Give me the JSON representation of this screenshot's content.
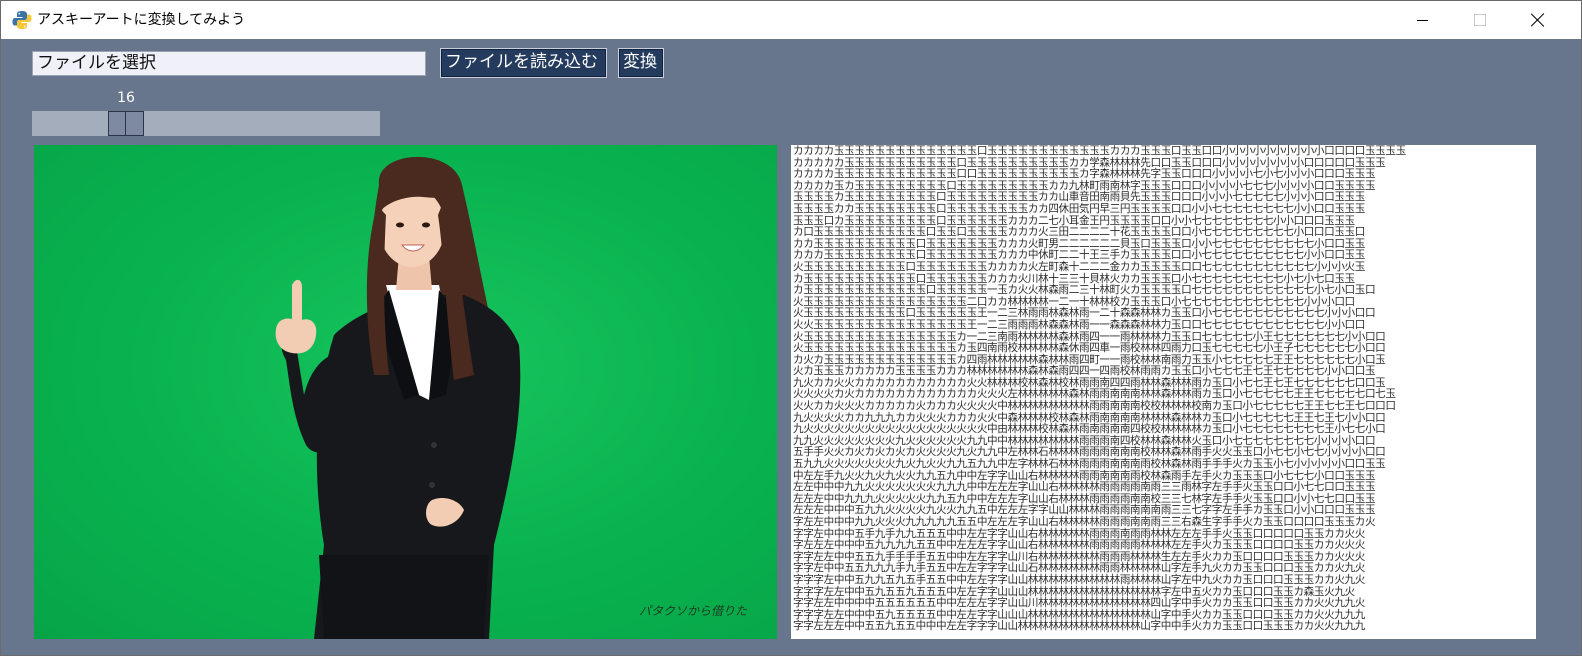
{
  "window": {
    "title": "アスキーアートに変換してみよう",
    "app_icon": "python-icon"
  },
  "controls": {
    "file_input_value": "ファイルを選択",
    "load_button_label": "ファイルを読み込む",
    "convert_button_label": "変換",
    "slider_value": "16"
  },
  "photo": {
    "credit": "パタクソから借りた"
  },
  "ascii_art": "カカカカ玉玉玉玉玉玉玉玉玉玉玉玉玉玉口玉玉玉玉玉玉玉玉玉玉玉玉カカカ玉玉玉口玉玉口口小小小小小小小小小小口口口口玉玉玉玉\nカカカカカ玉玉玉玉玉玉玉玉玉玉玉口玉玉玉玉玉玉玉玉玉玉カカ学森林林林先口口玉玉口口口小小小小小小小小口口口口口玉玉玉\nカカカカ玉玉玉玉玉玉玉玉玉玉玉玉口口玉玉玉玉玉玉玉玉玉玉カ字森林林林先字玉玉口口口小小小小七小七小小小口口口玉玉玉\nカカカカ玉カ玉玉玉玉玉玉玉玉玉口玉玉玉玉玉玉玉玉玉カカ九林町雨南林字玉玉玉口口口小小小小七七七小小小小口口玉玉玉玉\n玉玉玉玉カ玉玉玉玉玉玉玉玉玉口玉玉玉玉玉玉玉玉玉カカ山車音田南雨貝先玉玉玉口口口小小小七七七七七小小小口口玉玉玉\n玉玉玉玉カカ玉玉玉玉玉玉玉玉口玉玉玉玉玉玉玉玉カカ四休田気円早三円玉玉玉玉口口小小七七七七七七七七小小口口玉玉玉\n玉玉玉口カ玉玉玉玉玉玉玉玉玉口玉玉玉玉玉玉カカカ二七小耳金王円玉玉玉玉口口小小七七七七七七七七小小口口口玉玉玉\nカ口玉玉玉玉玉玉玉玉玉玉玉口玉玉口玉玉玉玉カカカ火三田二二二二十花玉玉玉玉口口小七七七七七七七七七小口口口玉玉口\nカカ玉玉玉玉玉玉玉玉玉玉口玉玉玉玉玉玉玉カカカ火町男二二二二二二貝玉口玉玉玉口小小七七七七七七七七七七小口口玉玉\nカカカ玉玉玉玉玉玉玉玉玉口玉玉玉玉玉玉玉カカカ中休町二二十王三手カ玉玉玉玉口口小七七七七七七七七七七小小口口玉玉\n火玉玉玉玉玉玉玉玉玉玉口玉玉玉玉玉玉玉カカカカ火左町森十二二二金カカ玉玉玉玉口口七七七七七七七七七七七小小小火玉\nカ玉玉玉玉玉玉玉玉玉玉玉口玉玉玉玉玉玉カカカ火川林十三三十貝林火カカ玉玉玉口小七七七七七七七七七小七小七口玉玉\nカ玉玉玉玉玉玉玉玉玉玉玉玉口玉玉玉玉玉一玉カ火火林森雨二三十林町火カ玉玉玉玉口七七七七七七七七七七七七小七小口玉口\n火玉玉玉玉玉玉玉玉玉玉玉玉玉玉玉玉二口カカ林林林林一二一十林林校カ玉玉玉口小七七七七七七七七七七七七小小小口口\n火玉玉玉玉玉玉玉玉玉玉口玉玉玉玉玉玉王一二三林雨雨林森林雨一二十森森林林カ玉玉口小七七七七七七七七七七七小小小口口\n火火玉玉玉玉玉玉玉玉玉玉玉玉玉玉玉王一二三雨雨雨林森森林雨一一森森森林林力玉口口七七七七七七七七七七七七小小口口\n火玉玉玉玉玉玉玉玉玉玉玉玉玉玉玉カ一二三南雨林林林林森林雨四一一雨林林林力玉玉口七七七七七小王七七七七七七七小小口口\n火玉玉玉玉玉玉玉玉玉玉玉玉玉玉玉カ玉四南雨校林林林林森休雨四車一雨校林林四雨力口玉七七七七七小王子七七七七七七小口口\nカ火カ玉玉玉玉玉玉玉玉玉玉玉玉玉カ四雨林林林林林森林林雨四町一一雨校林林南雨力玉玉小七七七七七王王七七七七七七小口玉\n火カ玉玉玉カカカカカ玉玉玉玉カカカ林林林林林林森林森雨四四一四雨校林雨雨カ玉玉口小七七七王七王七七七七七小小口口玉\n九火カカ火火カカカカカカカカカカカ火火林林林校林森林校林雨雨南四四雨林林森林林雨カ玉口小七七王七王七七七七七七口口玉\n火火火火カ火カカカカカカカカカカカカ火火火左林林林林林森林雨雨南南南林林森林林雨カ玉口小七七七七七王王七七七七七口七玉\n火火カカ火火火カカカカカ火カカカ火火火火中林林林林林林林林雨雨南南南校校林林林校南カ玉口小七七七七七王王七七王七口口口\n九火火火火カカ九九九カカ火火火カカカ火火中森林林林校林森林雨南南南南林林林森林林カ玉口小七七七七七王王七王七小小口口\n九火火火火火火火火火火火火火火火火火火中由林林林校林森林雨南雨南南四校校林林林林カ玉口小七七七七七七七七王小七七小口\n九九火火火火火火火火九火火火火火火九九中中林林林林林林林雨雨雨南四校林林森林林火玉口小七七七七七七七七小小小小口口\n五手手火火カ火カ火カ火カ火火火火九火九九中左林林石林林林雨雨雨南南南校林林森林雨手火火玉玉口小七七小七七小小小小口口\n五九九火火火火火火火九火九火火九九五九九中左字林林石林林雨雨雨南南南雨校林森林雨手手手火カ玉玉小七小小小小小口口玉玉\n中左左手九火火九火九火火九九五九中中左字字山山右林林林林雨雨南南南雨校林森雨手左手火カ玉玉玉口小七七七小口口玉玉玉\n左左中中中九九火火火火火火火九九九中中左左左字山山右林林林林雨雨雨雨南雨三三雨林字左手手火玉玉口口小七七口口玉玉玉\n左左左中中九九九火火火火火九九五九中中左左左字山山右林林林雨雨雨雨南南校三三七林字左手手火玉玉口口小小七七口口玉玉\n左左左中中中五九九火火火火九火火九九五中左左左字字山山林林林雨雨雨南南南雨三三七字字左手手カ玉玉口小小口口口玉玉玉\n字左左中中中九九火火火九九九九九五五中左左左字山山右林林林林雨雨雨南南雨三三右森生字手手火カ玉玉口口口口玉玉玉カ火\n字字左中中中五手九手九九五五五中中左左字字山山右林林林林林雨雨雨南雨雨林林左左左手手火玉玉口口口口口玉玉カカ火火\n字左左左中中中五九九九九五五中中左左左字字山山右林林林林林雨雨雨雨雨林林林左左手火カ玉玉玉口口口口玉玉カカ火火火\n字字左左中中五五九手手手手五五中中左左字字山川右林林林林林林雨雨雨林林林生左左手火カカ玉口口口口玉玉玉カカ火火火\n字字左中中五五九九九手九手五五中左左字字字山山石林林林林林林雨雨林林林林山字左手九火カカ玉玉口口口玉玉カカ火九火\n字字字左中中五九九五九五手五五中中左左字字山山林林林林林林林林林雨林林林山字左中九火カカ玉口口口玉玉玉カカ火九火\n字字字左左中中五九五五九五五五中左左字字山山山林林林林林林林林林林林林林字左中五火カカ玉口口口玉玉カ森玉火九火\n字字左左中中中中五五五五五五中中左左左字字山山川林林林林林林林林林林林四山字中手火カカ玉玉口口玉玉カカ火火九九火\n字字字左左中中中五九五五五五中中左左字字山山山林林林林林林林林林林林林山字中手火カカ玉玉口口口玉玉カカ火火九九九\n字字左左左中中五五九五五中中中左左字字字山山林林林林林林林林林林林林山字中中手火カカ玉玉口口玉玉玉カカ火火九九九"
}
